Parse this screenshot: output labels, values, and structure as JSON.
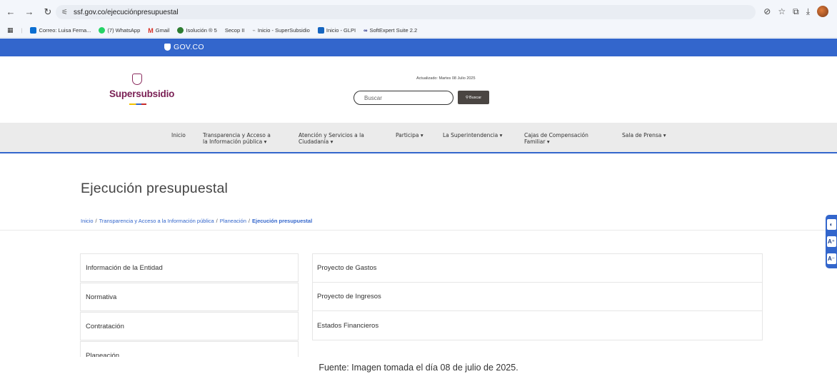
{
  "browser": {
    "url": "ssf.gov.co/ejecuciónpresupuestal",
    "bookmarks": [
      {
        "label": "Correo: Luisa Ferna...",
        "color": "#0a6ed1"
      },
      {
        "label": "(7) WhatsApp",
        "color": "#25d366"
      },
      {
        "label": "Gmail",
        "color": "#d93025"
      },
      {
        "label": "Isolución ® 5",
        "color": "#2e7d32"
      },
      {
        "label": "Secop II",
        "color": "#9e9e9e"
      },
      {
        "label": "Inicio - SuperSubsidio",
        "color": "#bdbdbd"
      },
      {
        "label": "Inicio - GLPI",
        "color": "#1565c0"
      },
      {
        "label": "SoftExpert Suite 2.2",
        "color": "#1a237e"
      }
    ]
  },
  "govbar": {
    "logo_text": "GOV.CO"
  },
  "header": {
    "logo_text": "Supersubsidio",
    "updated": "Actualizado: Martes 08 Julio 2025",
    "search_placeholder": "Buscar",
    "search_button": "Buscar"
  },
  "menu": {
    "items": [
      {
        "line1": "Inicio",
        "line2": ""
      },
      {
        "line1": "Transparencia y Acceso a",
        "line2": "la Información pública ▾"
      },
      {
        "line1": "Atención y Servicios a la",
        "line2": "Ciudadanía ▾"
      },
      {
        "line1": "Participa ▾",
        "line2": ""
      },
      {
        "line1": "La Superintendencia ▾",
        "line2": ""
      },
      {
        "line1": "Cajas de Compensación",
        "line2": "Familiar ▾"
      },
      {
        "line1": "Sala de Prensa ▾",
        "line2": ""
      }
    ]
  },
  "page": {
    "title": "Ejecución presupuestal",
    "breadcrumb": [
      "Inicio",
      "Transparencia y Acceso a la Información pública",
      "Planeación",
      "Ejecución presupuestal"
    ]
  },
  "sidebar": {
    "items": [
      "Información de la Entidad",
      "Normativa",
      "Contratación",
      "Planeación"
    ]
  },
  "documents": {
    "items": [
      "Proyecto de Gastos",
      "Proyecto de Ingresos",
      "Estados Financieros"
    ]
  },
  "accessibility": {
    "buttons": [
      "◐",
      "A⁺",
      "A⁻"
    ]
  },
  "caption": "Fuente: Imagen tomada el día 08 de julio de 2025."
}
